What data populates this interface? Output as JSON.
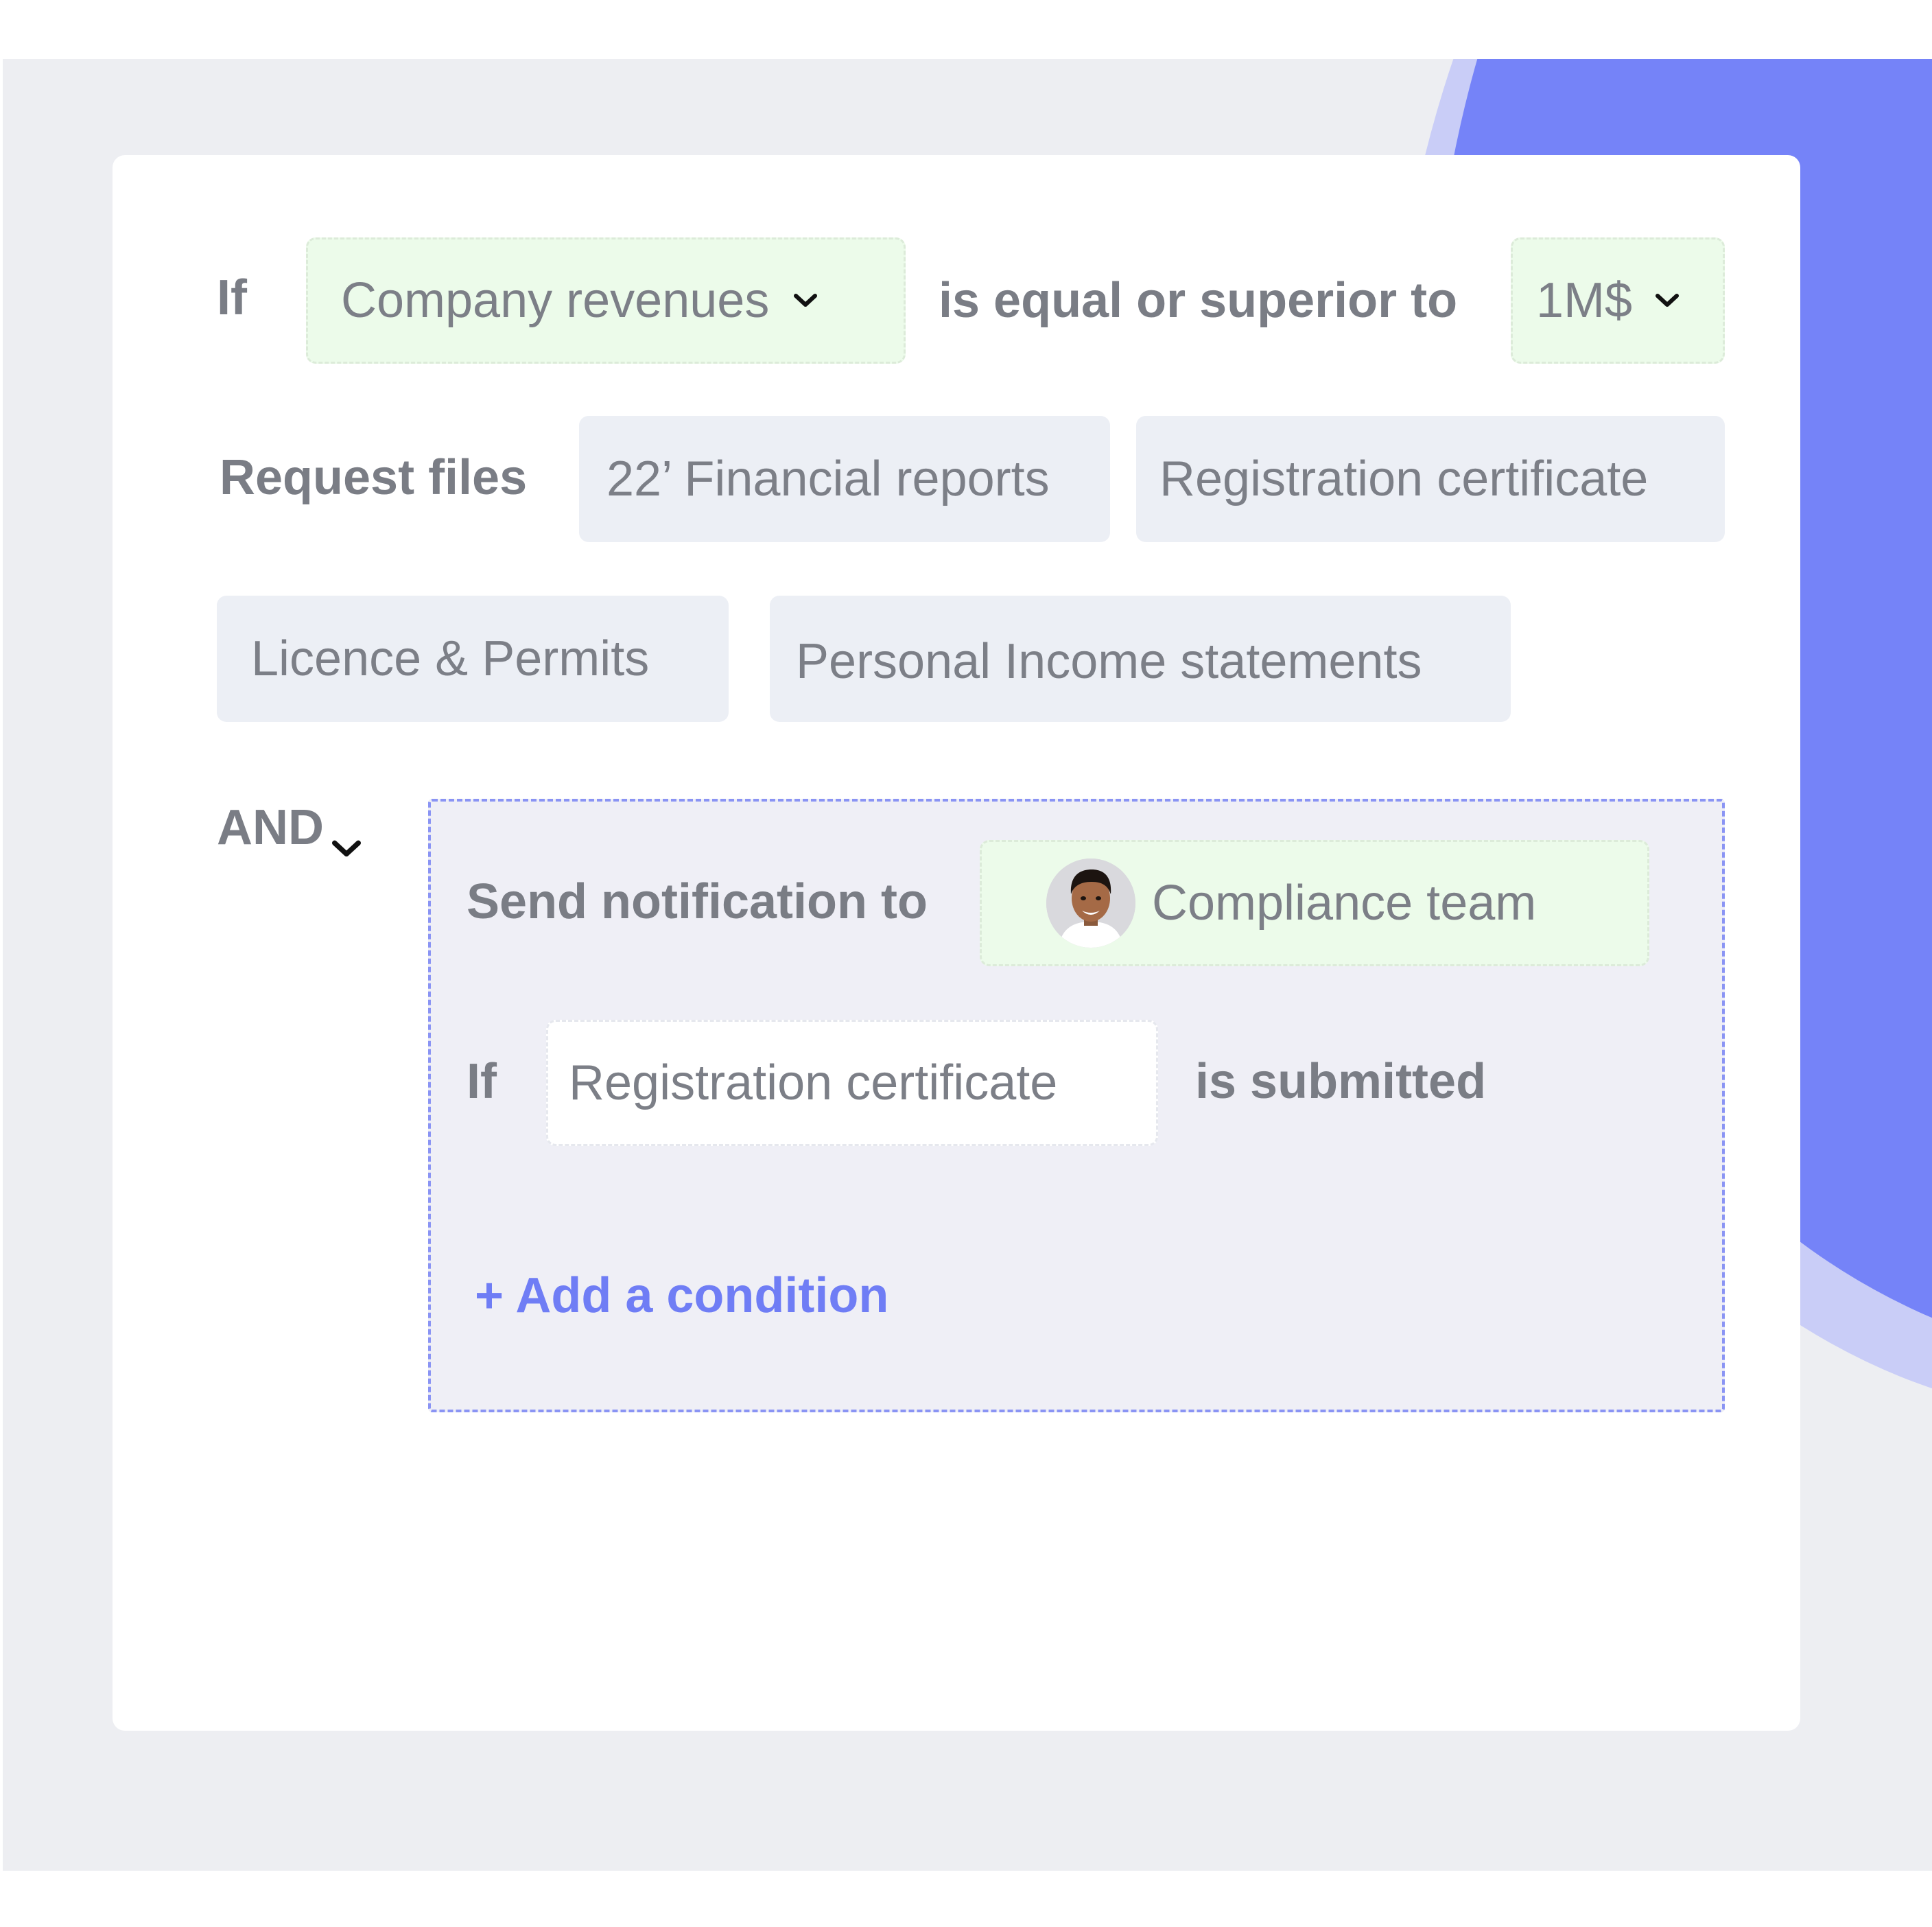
{
  "rule": {
    "if_label": "If",
    "condition_field": "Company revenues",
    "operator": "is equal or superior to",
    "threshold": "1M$"
  },
  "request": {
    "label": "Request files",
    "files": [
      "22’ Financial reports",
      "Registration certificate",
      "Licence & Permits",
      "Personal Income statements"
    ]
  },
  "connector": {
    "label": "AND"
  },
  "group": {
    "notification_label": "Send notification to",
    "recipient": "Compliance team",
    "if_label": "If",
    "condition_document": "Registration certificate",
    "condition_status": "is submitted",
    "add_condition": "+ Add a condition"
  },
  "colors": {
    "accent": "#6f7df5",
    "accent_blob": "#7583f8",
    "chip_green": "#ecfbea",
    "chip_gray": "#eceff5",
    "background": "#edeef2"
  },
  "icons": {
    "dropdown": "chevron-down-icon",
    "avatar": "user-avatar"
  }
}
